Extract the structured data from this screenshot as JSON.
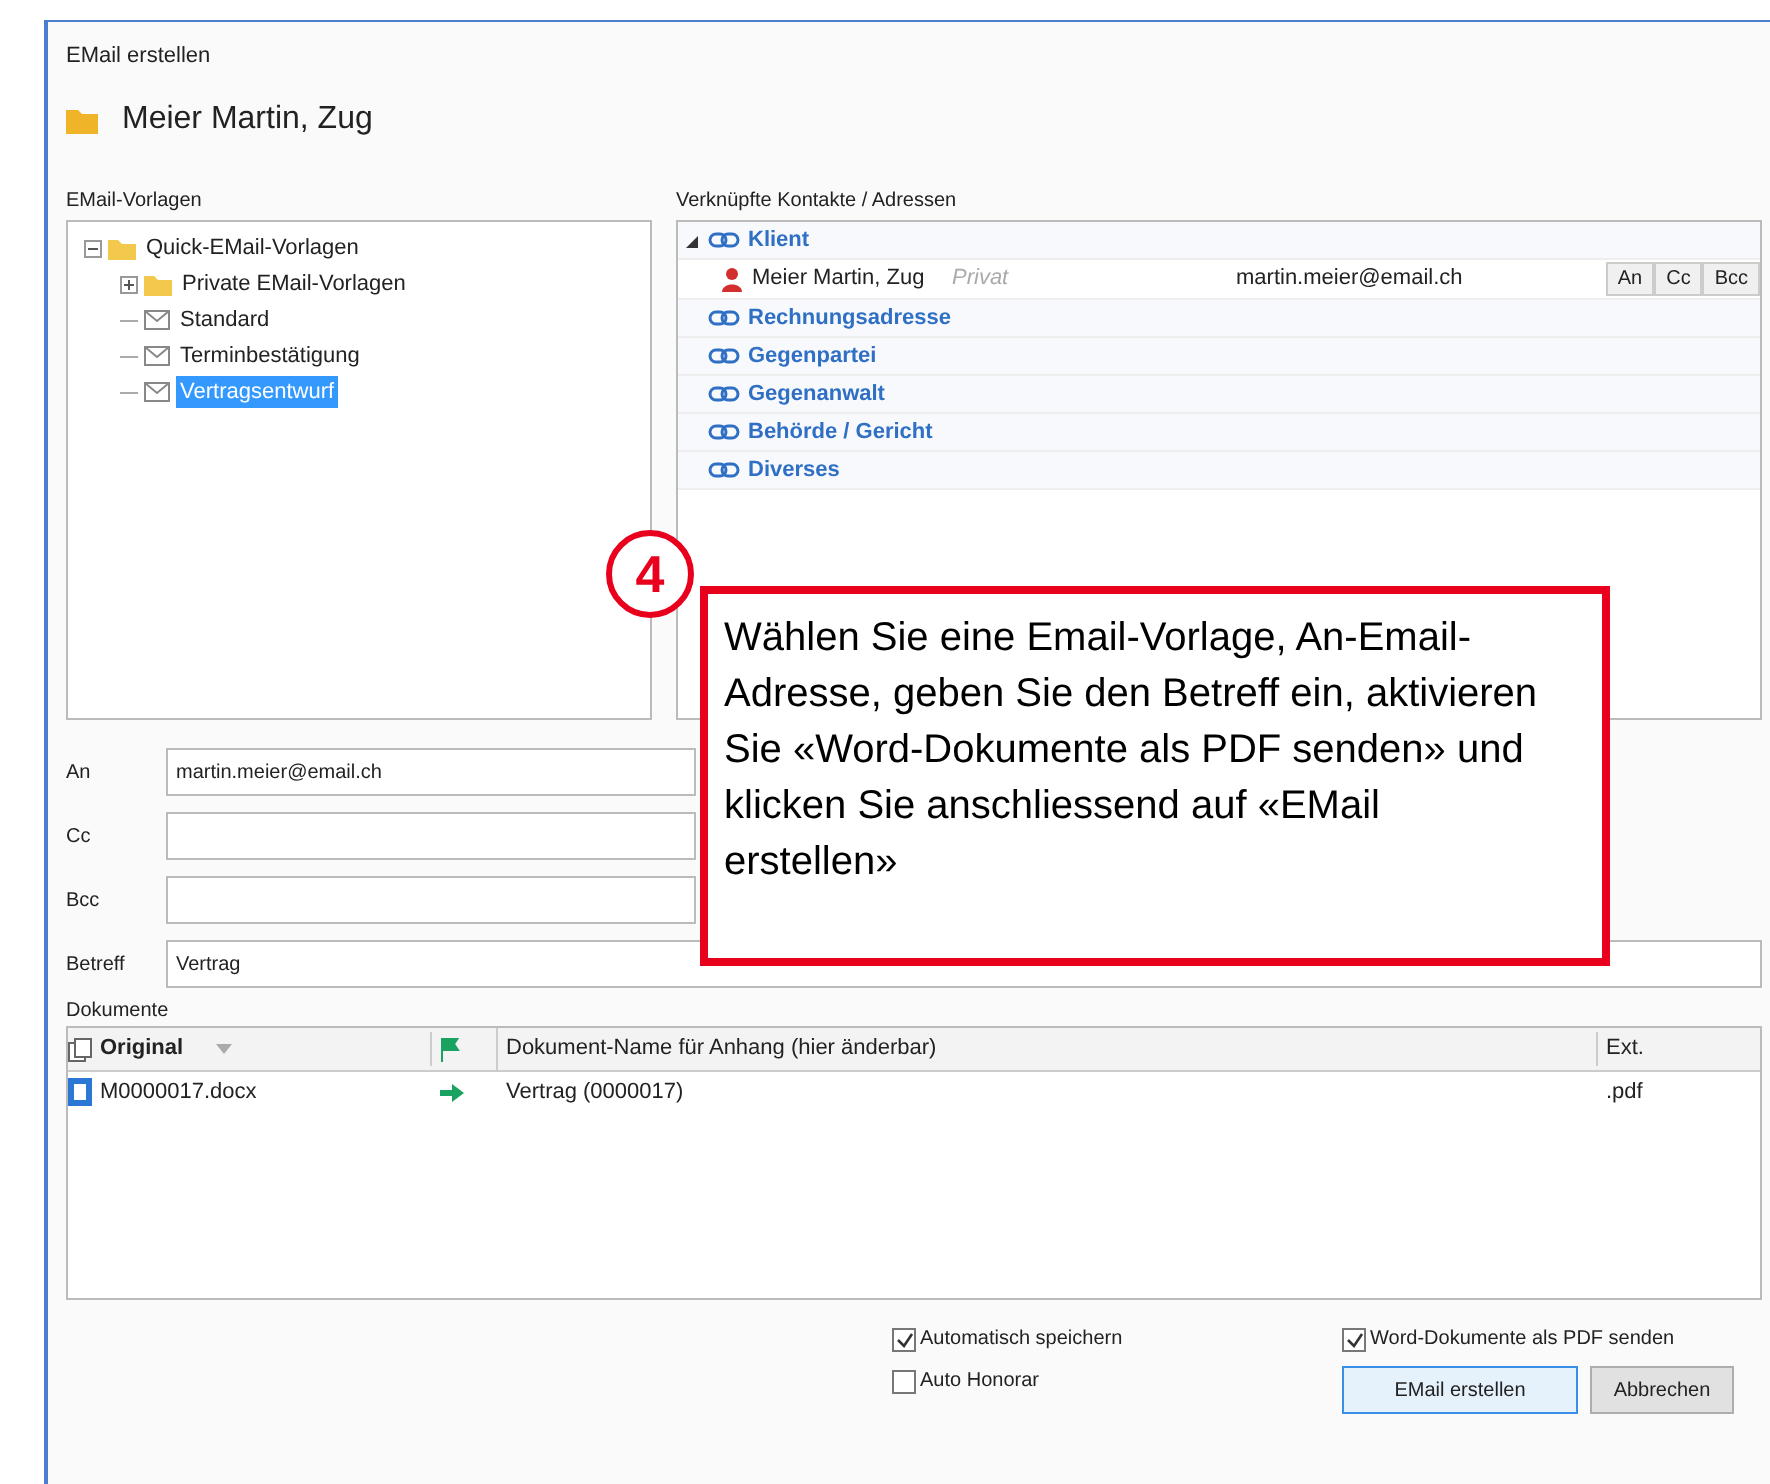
{
  "window": {
    "title": "EMail erstellen"
  },
  "header": {
    "title": "Meier Martin, Zug"
  },
  "templates": {
    "label": "EMail-Vorlagen",
    "tree": [
      {
        "label": "Quick-EMail-Vorlagen",
        "kind": "folder",
        "expanded": true,
        "selected": false,
        "children": [
          {
            "label": "Private EMail-Vorlagen",
            "kind": "folder",
            "expanded": false,
            "selected": false
          },
          {
            "label": "Standard",
            "kind": "template",
            "selected": false
          },
          {
            "label": "Terminbestätigung",
            "kind": "template",
            "selected": false
          },
          {
            "label": "Vertragsentwurf",
            "kind": "template",
            "selected": true
          }
        ]
      }
    ]
  },
  "contacts": {
    "label": "Verknüpfte Kontakte / Adressen",
    "groups": [
      {
        "label": "Klient",
        "expanded": true,
        "contacts": [
          {
            "name": "Meier Martin, Zug",
            "type": "Privat",
            "email": "martin.meier@email.ch",
            "buttons": [
              "An",
              "Cc",
              "Bcc"
            ]
          }
        ]
      },
      {
        "label": "Rechnungsadresse"
      },
      {
        "label": "Gegenpartei"
      },
      {
        "label": "Gegenanwalt"
      },
      {
        "label": "Behörde / Gericht"
      },
      {
        "label": "Diverses"
      }
    ]
  },
  "fields": [
    {
      "label": "An",
      "value": "martin.meier@email.ch"
    },
    {
      "label": "Cc"
    },
    {
      "label": "Bcc"
    },
    {
      "label": "Betreff",
      "value": "Vertrag"
    }
  ],
  "documents": {
    "label": "Dokumente",
    "columns": [
      "Original",
      "Dokument-Name für Anhang (hier änderbar)",
      "Ext."
    ],
    "rows": [
      {
        "original": "M0000017.docx",
        "name": "Vertrag (0000017)",
        "ext": ".pdf"
      }
    ]
  },
  "options": [
    {
      "label": "Automatisch speichern",
      "checked": true
    },
    {
      "label": "Auto Honorar",
      "checked": false
    },
    {
      "label": "Word-Dokumente als PDF senden",
      "checked": true
    }
  ],
  "buttons": [
    {
      "label": "EMail erstellen",
      "kind": "primary"
    },
    {
      "label": "Abbrechen",
      "kind": "secondary"
    }
  ],
  "callout": {
    "number": "4",
    "text": "Wählen Sie eine Email-Vorlage, An-Email-Adresse, geben Sie den Betreff ein, aktivieren Sie «Word-Dokumente als PDF senden» und klicken Sie anschliessend auf «EMail erstellen»"
  }
}
